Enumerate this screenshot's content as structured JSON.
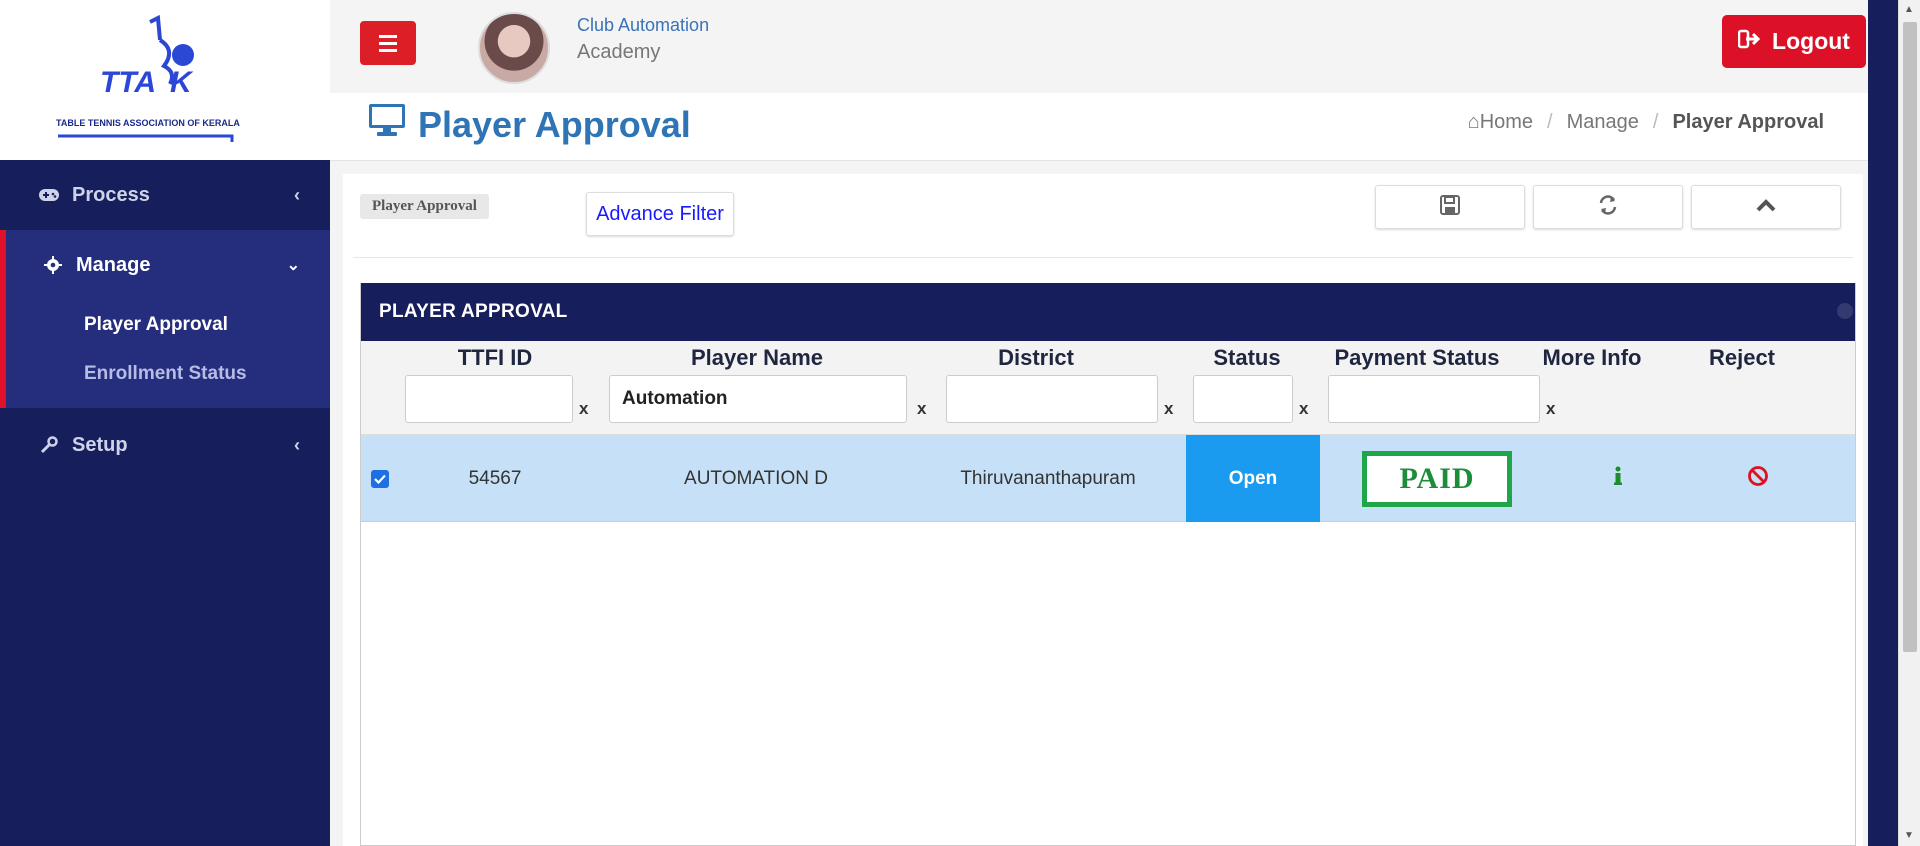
{
  "logo": {
    "name": "TTAK",
    "caption": "TABLE TENNIS ASSOCIATION OF KERALA"
  },
  "sidebar": {
    "items": [
      {
        "label": "Process",
        "icon": "gamepad-icon"
      },
      {
        "label": "Manage",
        "icon": "gear-icon"
      },
      {
        "label": "Setup",
        "icon": "wrench-icon"
      }
    ],
    "manage_subitems": [
      {
        "label": "Player Approval",
        "active": true
      },
      {
        "label": "Enrollment Status",
        "active": false
      }
    ]
  },
  "header": {
    "club_line1": "Club Automation",
    "club_line2": "Academy",
    "logout_label": "Logout"
  },
  "page": {
    "title": "Player Approval",
    "breadcrumb": [
      "Home",
      "Manage",
      "Player Approval"
    ]
  },
  "toolbar": {
    "tag": "Player Approval",
    "advance_filter": "Advance Filter"
  },
  "grid": {
    "title": "PLAYER APPROVAL",
    "columns": [
      "TTFI ID",
      "Player Name",
      "District",
      "Status",
      "Payment Status",
      "More Info",
      "Reject"
    ],
    "filters": [
      "",
      "Automation",
      "",
      "",
      ""
    ],
    "filter_clear": "x",
    "rows": [
      {
        "checked": true,
        "ttfi_id": "54567",
        "player_name": "AUTOMATION D",
        "district": "Thiruvananthapuram",
        "status": "Open",
        "payment_status": "PAID"
      }
    ]
  },
  "colors": {
    "sidebar_bg": "#171e5c",
    "accent_red": "#dc1f26",
    "title_blue": "#2f74b5",
    "status_blue": "#1b9bf0",
    "paid_green": "#1fa64a",
    "row_bg": "#c6e1f7"
  }
}
